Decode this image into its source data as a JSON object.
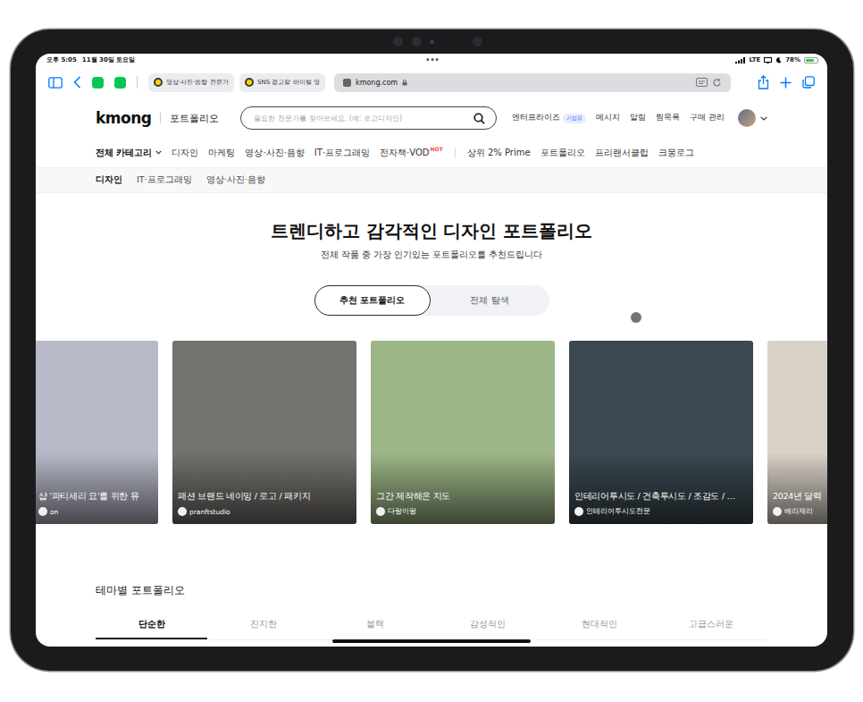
{
  "status_bar": {
    "time": "오후 5:05",
    "date": "11월 30일 토요일",
    "dots": "•••",
    "network": "LTE",
    "battery": "78%",
    "battery_level": 0.78
  },
  "browser": {
    "tabs": [
      {
        "label": "영상·사진·음향 전문가",
        "selected": false
      },
      {
        "label": "SNS 광고할 바이럴 영",
        "selected": false
      },
      {
        "label": "kmong.com",
        "selected": true
      }
    ]
  },
  "header": {
    "logo": "kmong",
    "section": "포트폴리오",
    "search": {
      "placeholder": "필요한 전문가를 찾아보세요. (예: 로고디자인)"
    },
    "links": [
      {
        "label": "엔터프라이즈",
        "badge": "기업용"
      },
      {
        "label": "메시지"
      },
      {
        "label": "알림"
      },
      {
        "label": "찜목록"
      },
      {
        "label": "구매 관리"
      }
    ]
  },
  "nav": {
    "all": "전체 카테고리",
    "categories": [
      {
        "label": "디자인"
      },
      {
        "label": "마케팅"
      },
      {
        "label": "영상·사진·음향"
      },
      {
        "label": "IT·프로그래밍"
      },
      {
        "label": "전자책·VOD",
        "badge": "HOT"
      }
    ],
    "extras": [
      "상위 2% Prime",
      "포트폴리오",
      "프리랜서클럽",
      "크몽로그"
    ]
  },
  "subnav": [
    {
      "label": "디자인",
      "selected": true
    },
    {
      "label": "IT·프로그래밍",
      "selected": false
    },
    {
      "label": "영상·사진·음향",
      "selected": false
    }
  ],
  "hero": {
    "title": "트렌디하고 감각적인 디자인 포트폴리오",
    "subtitle": "전체 작품 중 가장 인기있는 포트폴리오를 추천드립니다",
    "toggle": [
      {
        "label": "추천 포트폴리오",
        "selected": true
      },
      {
        "label": "전체 탐색",
        "selected": false
      }
    ]
  },
  "cards": [
    {
      "title": "샵 '파티세리 묘'를 위한 뮤",
      "author": "on",
      "color": "#b7b9c8"
    },
    {
      "title": "패션 브랜드 네이밍 / 로고 / 패키지",
      "author": "pranftstudio",
      "color": "#74726e"
    },
    {
      "title": "그간 제작해온 지도",
      "author": "다랑이랑",
      "color": "#9db687"
    },
    {
      "title": "인테리어투시도 / 건축투시도 / 조감도 / …",
      "author": "인테리어투시도전문",
      "color": "#3a4850"
    },
    {
      "title": "2024년 달력",
      "author": "베리제리",
      "color": "#d9d2c8"
    }
  ],
  "themes": {
    "title": "테마별 포트폴리오",
    "tabs": [
      {
        "label": "단순한",
        "selected": true
      },
      {
        "label": "진지한",
        "selected": false
      },
      {
        "label": "블랙",
        "selected": false
      },
      {
        "label": "감성적인",
        "selected": false
      },
      {
        "label": "현대적인",
        "selected": false
      },
      {
        "label": "고급스러운",
        "selected": false
      }
    ]
  }
}
